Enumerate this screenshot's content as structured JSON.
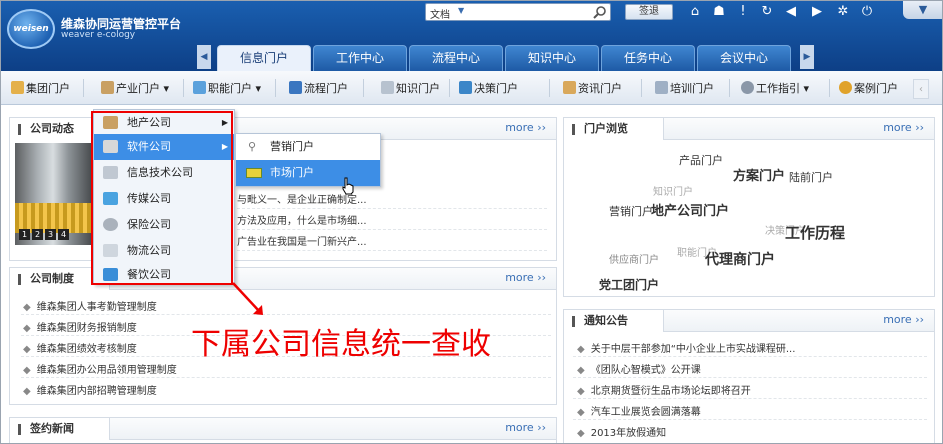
{
  "app": {
    "logo_text": "weisen",
    "title": "维森协同运营管控平台",
    "subtitle": "weaver e-cology"
  },
  "search": {
    "scope": "文档",
    "button": "签退"
  },
  "toolbar_icons": [
    "home-icon",
    "user-icon",
    "alert-icon",
    "refresh-icon",
    "back-icon",
    "forward-icon",
    "settings-icon",
    "power-icon"
  ],
  "main_tabs": [
    {
      "label": "信息门户",
      "active": true
    },
    {
      "label": "工作中心",
      "active": false
    },
    {
      "label": "流程中心",
      "active": false
    },
    {
      "label": "知识中心",
      "active": false
    },
    {
      "label": "任务中心",
      "active": false
    },
    {
      "label": "会议中心",
      "active": false
    }
  ],
  "sub_nav": [
    {
      "label": "集团门户"
    },
    {
      "label": "产业门户",
      "dropdown": true
    },
    {
      "label": "职能门户",
      "dropdown": true
    },
    {
      "label": "流程门户"
    },
    {
      "label": "知识门户"
    },
    {
      "label": "决策门户"
    },
    {
      "label": "资讯门户"
    },
    {
      "label": "培训门户"
    },
    {
      "label": "工作指引",
      "dropdown": true
    },
    {
      "label": "案例门户"
    }
  ],
  "dropdown": {
    "items": [
      {
        "label": "地产公司",
        "submenu": true
      },
      {
        "label": "软件公司",
        "submenu": true,
        "highlighted": true
      },
      {
        "label": "信息技术公司"
      },
      {
        "label": "传媒公司"
      },
      {
        "label": "保险公司"
      },
      {
        "label": "物流公司"
      },
      {
        "label": "餐饮公司"
      }
    ],
    "submenu": [
      {
        "label": "营销门户"
      },
      {
        "label": "市场门户",
        "highlighted": true
      }
    ]
  },
  "callout": "下属公司信息统一查收",
  "more_label": "more",
  "panels": {
    "company_news": {
      "title": "公司动态",
      "items": [
        "与毗义一、是企业正确制定...",
        "方法及应用，什么是市场细...",
        "广告业在我国是一门新兴产..."
      ],
      "pager": [
        "1",
        "2",
        "3",
        "4"
      ]
    },
    "company_rules": {
      "title": "公司制度",
      "items": [
        "维森集团人事考勤管理制度",
        "维森集团财务报销制度",
        "维森集团绩效考核制度",
        "维森集团办公用品领用管理制度",
        "维森集团内部招聘管理制度"
      ]
    },
    "signing_news": {
      "title": "签约新闻"
    },
    "portal_browse": {
      "title": "门户浏览",
      "tags": [
        {
          "text": "产品门户",
          "size": "m"
        },
        {
          "text": "方案门户",
          "size": "l"
        },
        {
          "text": "陆前门户",
          "size": "m"
        },
        {
          "text": "知识门户",
          "size": "s"
        },
        {
          "text": "营销门户",
          "size": "m"
        },
        {
          "text": "地产公司门户",
          "size": "l"
        },
        {
          "text": "决策门户",
          "size": "s"
        },
        {
          "text": "工作历程",
          "size": "xl"
        },
        {
          "text": "职能门户",
          "size": "s"
        },
        {
          "text": "供应商门户",
          "size": "s"
        },
        {
          "text": "代理商门户",
          "size": "xl"
        },
        {
          "text": "党工团门户",
          "size": "l"
        }
      ]
    },
    "notices": {
      "title": "通知公告",
      "items": [
        "关于中层干部参加“中小企业上市实战课程研...",
        "《团队心智模式》公开课",
        "北京期货暨衍生品市场论坛即将召开",
        "汽车工业展览会圆满落幕",
        "2013年放假通知"
      ]
    }
  },
  "colors": {
    "header": "#1a5fb0",
    "highlight": "#3d8ee6",
    "callout": "#e00000",
    "link": "#3a6fb5"
  }
}
